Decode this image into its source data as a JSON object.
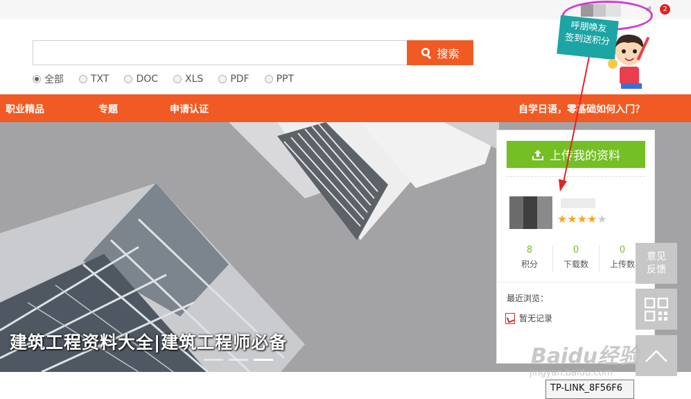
{
  "topbar": {
    "notification_count": "2"
  },
  "search": {
    "value": "",
    "button_label": "搜索",
    "filters": [
      {
        "label": "全部",
        "selected": true
      },
      {
        "label": "TXT",
        "selected": false
      },
      {
        "label": "DOC",
        "selected": false
      },
      {
        "label": "XLS",
        "selected": false
      },
      {
        "label": "PDF",
        "selected": false
      },
      {
        "label": "PPT",
        "selected": false
      }
    ]
  },
  "nav": {
    "items": [
      "职业精品",
      "专题",
      "申请认证"
    ],
    "right_link": "自学日语，零基础如何入门？"
  },
  "banner": {
    "title": "建筑工程资料大全|建筑工程师必备",
    "slide_count": 3,
    "active_slide": 3
  },
  "promo": {
    "line1": "呼朋唤友",
    "line2": "签到送积分"
  },
  "user_card": {
    "upload_label": "上传我的资料",
    "rating": 4,
    "rating_max": 5,
    "stats": [
      {
        "value": "8",
        "label": "积分"
      },
      {
        "value": "0",
        "label": "下载数"
      },
      {
        "value": "0",
        "label": "上传数"
      }
    ],
    "recent_label": "最近浏览：",
    "recent_empty": "暂无记录"
  },
  "side_tools": {
    "feedback_line1": "意见",
    "feedback_line2": "反馈"
  },
  "watermark": {
    "text": "Baidu经验",
    "sub": "jingyan.baidu.com"
  },
  "tooltip": {
    "text": "TP-LINK_8F56F6"
  },
  "colors": {
    "accent": "#f15a23",
    "green": "#73bf24",
    "promo": "#1da4a4",
    "annotation": "#d437d6"
  }
}
